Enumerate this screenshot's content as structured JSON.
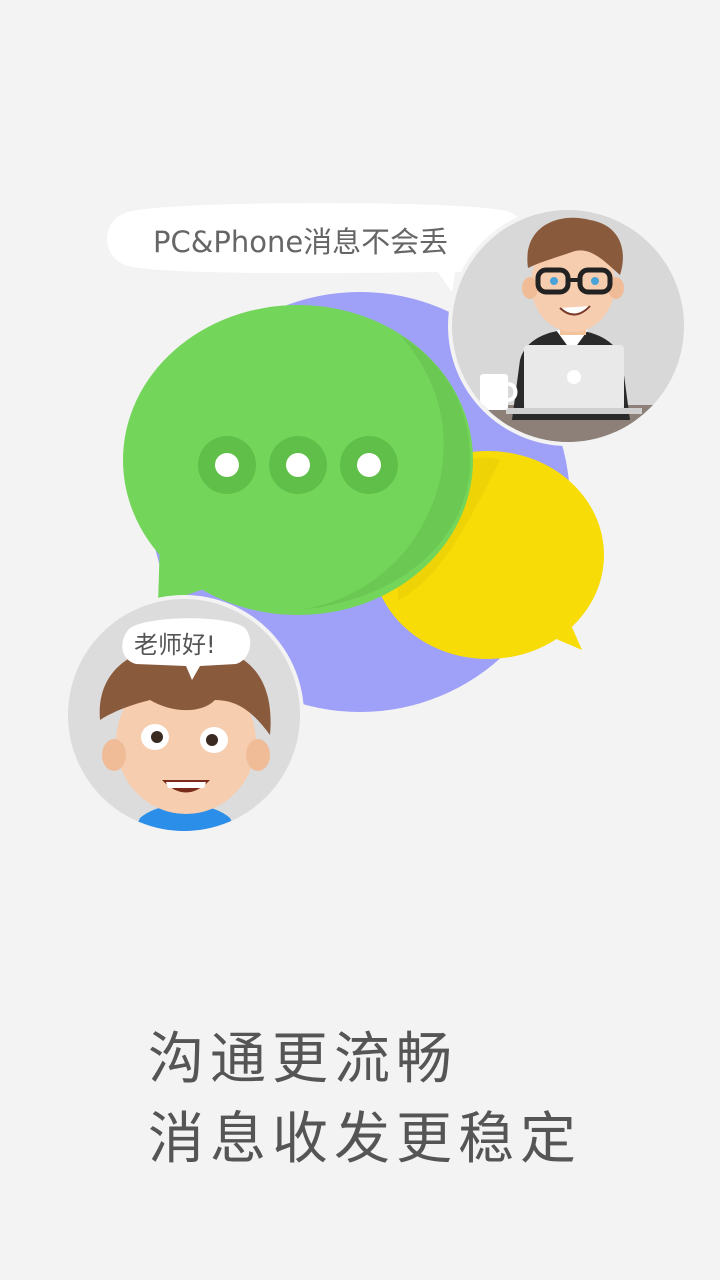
{
  "illustration": {
    "top_speech_bubble": "PC&Phone消息不会丢",
    "student_speech_bubble": "老师好!",
    "colors": {
      "background": "#f3f3f3",
      "green_bubble": "#74d55b",
      "yellow_bubble": "#f8dc07",
      "purple_circle": "#9fa0f8"
    }
  },
  "captions": {
    "line1": "沟通更流畅",
    "line2": "消息收发更稳定"
  }
}
